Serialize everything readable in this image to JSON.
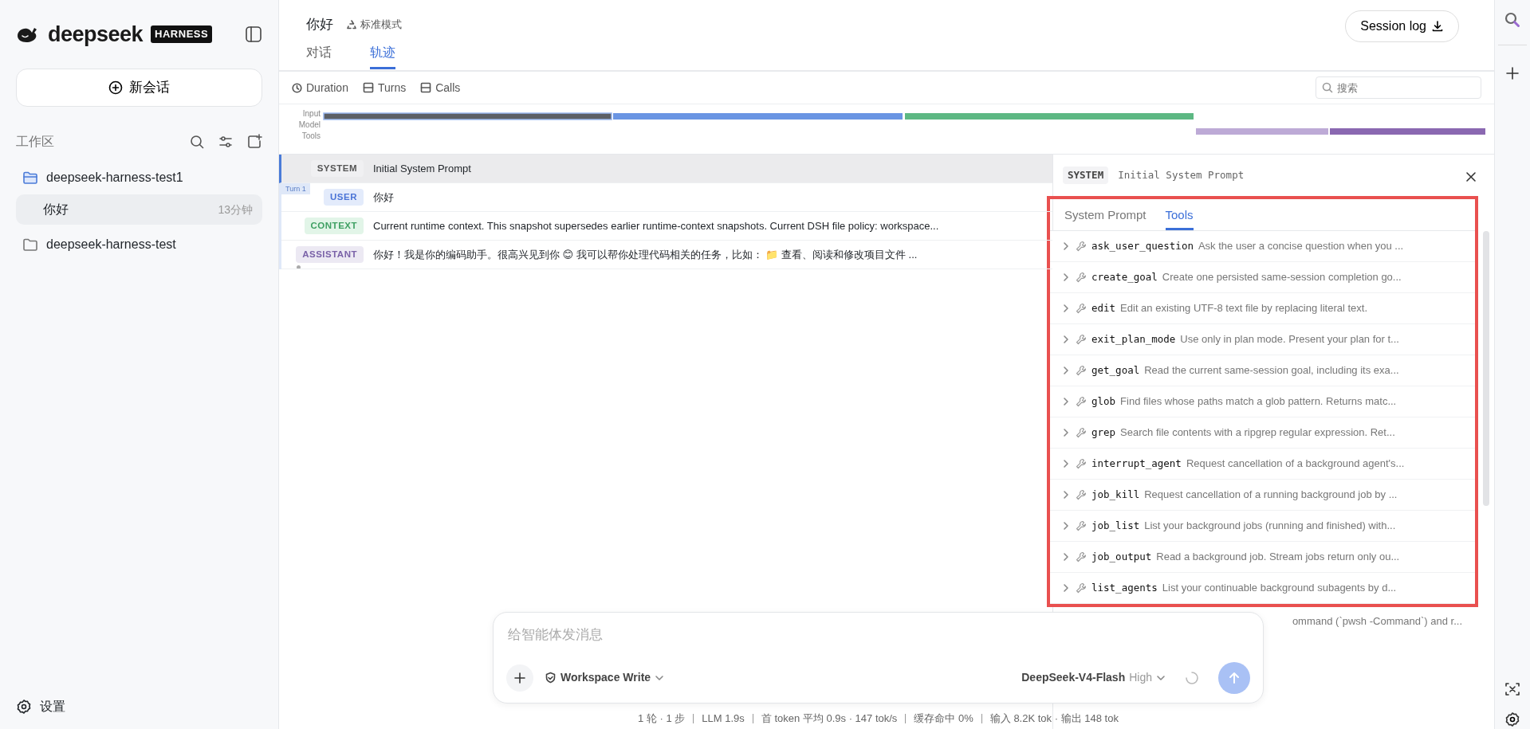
{
  "sidebar": {
    "logo": {
      "wordmark": "deepseek",
      "badge": "HARNESS"
    },
    "new_chat": "新会话",
    "section_title": "工作区",
    "workspaces": [
      {
        "name": "deepseek-harness-test1",
        "expanded": true,
        "children": [
          {
            "title": "你好",
            "time": "13分钟",
            "selected": true
          }
        ]
      },
      {
        "name": "deepseek-harness-test",
        "expanded": false
      }
    ],
    "settings": "设置"
  },
  "header": {
    "title": "你好",
    "mode": "标准模式",
    "tabs": [
      {
        "label": "对话",
        "selected": false
      },
      {
        "label": "轨迹",
        "selected": true
      }
    ],
    "session_log": "Session log"
  },
  "toolbar": {
    "views": [
      {
        "label": "Duration",
        "kind": "clock"
      },
      {
        "label": "Turns",
        "kind": "panel"
      },
      {
        "label": "Calls",
        "kind": "panel"
      }
    ],
    "search": {
      "placeholder": "搜索"
    }
  },
  "timeline": {
    "lanes": [
      "Input",
      "Model",
      "Tools"
    ]
  },
  "turn_marker": "Turn 1",
  "messages": [
    {
      "role": "SYSTEM",
      "kind": "system",
      "text": "Initial System Prompt",
      "selected": true
    },
    {
      "role": "USER",
      "kind": "user",
      "text": "你好",
      "selected": false
    },
    {
      "role": "CONTEXT",
      "kind": "context",
      "text": "Current runtime context. This snapshot supersedes earlier runtime-context snapshots. Current DSH file policy: workspace...",
      "selected": false
    },
    {
      "role": "ASSISTANT",
      "kind": "assistant",
      "text": "你好！我是你的编码助手。很高兴见到你 😊 我可以帮你处理代码相关的任务，比如： 📁 查看、阅读和修改项目文件 ...",
      "selected": false
    }
  ],
  "detail": {
    "role": "SYSTEM",
    "title": "Initial System Prompt",
    "highlighted": true,
    "tabs": [
      {
        "label": "System Prompt",
        "selected": false
      },
      {
        "label": "Tools",
        "selected": true
      }
    ],
    "tools": [
      {
        "name": "ask_user_question",
        "description": "Ask the user a concise question when you ..."
      },
      {
        "name": "create_goal",
        "description": "Create one persisted same-session completion go..."
      },
      {
        "name": "edit",
        "description": "Edit an existing UTF-8 text file by replacing literal text."
      },
      {
        "name": "exit_plan_mode",
        "description": "Use only in plan mode. Present your plan for t..."
      },
      {
        "name": "get_goal",
        "description": "Read the current same-session goal, including its exa..."
      },
      {
        "name": "glob",
        "description": "Find files whose paths match a glob pattern. Returns matc..."
      },
      {
        "name": "grep",
        "description": "Search file contents with a ripgrep regular expression. Ret..."
      },
      {
        "name": "interrupt_agent",
        "description": "Request cancellation of a background agent's..."
      },
      {
        "name": "job_kill",
        "description": "Request cancellation of a running background job by ..."
      },
      {
        "name": "job_list",
        "description": "List your background jobs (running and finished) with..."
      },
      {
        "name": "job_output",
        "description": "Read a background job. Stream jobs return only ou..."
      },
      {
        "name": "list_agents",
        "description": "List your continuable background subagents by d..."
      }
    ],
    "partial_text": "ommand (`pwsh -Command`) and r..."
  },
  "composer": {
    "placeholder": "给智能体发消息",
    "permission": "Workspace Write",
    "model": "DeepSeek-V4-Flash",
    "effort": "High"
  },
  "status_bar": [
    "1 轮 · 1 步",
    "LLM 1.9s",
    "首 token 平均 0.9s · 147 tok/s",
    "缓存命中 0%",
    "输入 8.2K tok · 输出 148 tok"
  ]
}
